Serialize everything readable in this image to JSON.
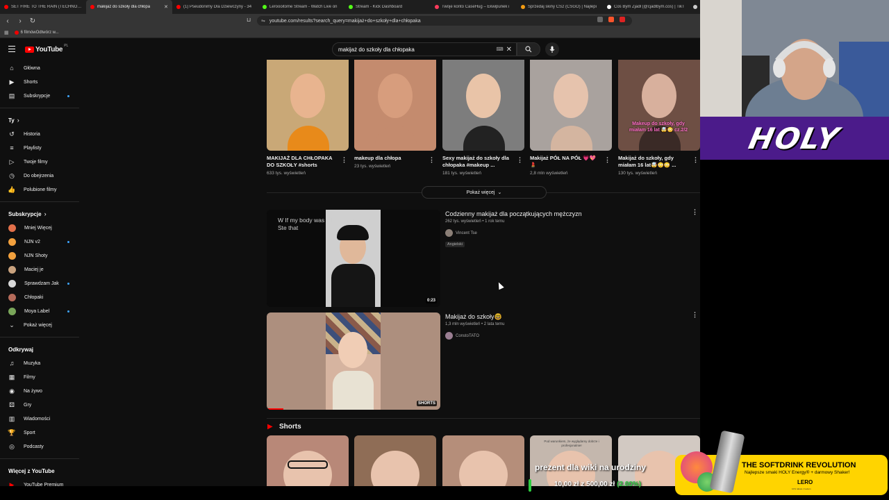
{
  "browser": {
    "tabs": [
      {
        "title": "SET FIRE TO THE RAIN (TECHNO) - Y",
        "color": "#ff0000",
        "active": false
      },
      {
        "title": "makijaż do szkoły dla chłopa",
        "color": "#ff0000",
        "active": true
      },
      {
        "title": "(1) Pseudonimy Dla Dziewczyny - 34",
        "color": "#ff0000",
        "active": false
      },
      {
        "title": "Leroooitome Stream - Watch Live on",
        "color": "#53fc18",
        "active": false
      },
      {
        "title": "Stream - Kick Dashboard",
        "color": "#53fc18",
        "active": false
      },
      {
        "title": "Twoje konto CaseHug – Ekwipunek i",
        "color": "#ff3b5c",
        "active": false
      },
      {
        "title": "Sprzedaj skiny CS2 (CSGO) | Najlepi",
        "color": "#f39c12",
        "active": false
      },
      {
        "title": "Coś Bym Zjadł (@cjadlbym.cos) | TikT",
        "color": "#ffffff",
        "active": false
      },
      {
        "title": "20",
        "color": "#cccccc",
        "active": false
      }
    ],
    "url": "youtube.com/results?search_query=makijaż+do+szkoły+dla+chłopaka",
    "bookmark": "6 filmówOdtwórz w..."
  },
  "youtube": {
    "logo": "YouTube",
    "country": "PL",
    "search_query": "makijaż do szkoły dla chłopaka",
    "sidebar": {
      "main": [
        {
          "label": "Główna",
          "icon": "home-icon"
        },
        {
          "label": "Shorts",
          "icon": "shorts-icon"
        },
        {
          "label": "Subskrypcje",
          "icon": "subscriptions-icon"
        }
      ],
      "you_header": "Ty",
      "you": [
        {
          "label": "Historia",
          "icon": "history-icon"
        },
        {
          "label": "Playlisty",
          "icon": "playlists-icon"
        },
        {
          "label": "Twoje filmy",
          "icon": "your-videos-icon"
        },
        {
          "label": "Do obejrzenia",
          "icon": "watch-later-icon"
        },
        {
          "label": "Polubione filmy",
          "icon": "liked-icon"
        }
      ],
      "subs_header": "Subskrypcje",
      "subs": [
        {
          "label": "Mniej Więcej",
          "color": "#e2704a",
          "dot": false
        },
        {
          "label": "NJN v2",
          "color": "#f2a03d",
          "dot": true
        },
        {
          "label": "NJN Shoty",
          "color": "#f2a03d",
          "dot": false
        },
        {
          "label": "Maciej je",
          "color": "#c9a27e",
          "dot": false
        },
        {
          "label": "Sprawdzam Jak",
          "color": "#d8d8d8",
          "dot": true
        },
        {
          "label": "Chłopaki",
          "color": "#b56b5a",
          "dot": false
        },
        {
          "label": "Moya Label",
          "color": "#7aa65a",
          "dot": true
        },
        {
          "label": "Pokaż więcej",
          "color": "",
          "dot": false
        }
      ],
      "explore_header": "Odkrywaj",
      "explore": [
        {
          "label": "Muzyka",
          "icon": "music-icon"
        },
        {
          "label": "Filmy",
          "icon": "movies-icon"
        },
        {
          "label": "Na żywo",
          "icon": "live-icon"
        },
        {
          "label": "Gry",
          "icon": "gaming-icon"
        },
        {
          "label": "Wiadomości",
          "icon": "news-icon"
        },
        {
          "label": "Sport",
          "icon": "sport-icon"
        },
        {
          "label": "Podcasty",
          "icon": "podcasts-icon"
        }
      ],
      "more_header": "Więcej z YouTube",
      "more": [
        {
          "label": "YouTube Premium",
          "icon": "youtube-premium-icon"
        }
      ]
    },
    "shorts_row": [
      {
        "title": "MAKIJAŻ DLA CHŁOPAKA DO SZKOŁY #shorts",
        "views": "633 tys. wyświetleń",
        "bg": "#c9a877",
        "shirt": "#e88a1a",
        "face": "#e8b48f"
      },
      {
        "title": "makeup dla chłopa",
        "views": "23 tys. wyświetleń",
        "bg": "#c48b6e",
        "shirt": "#c48b6e",
        "face": "#d79d7d"
      },
      {
        "title": "Sexy makijaż do szkoły dla chłopaka #makeup ...",
        "views": "181 tys. wyświetleń",
        "bg": "#7d7d7d",
        "shirt": "#222222",
        "face": "#e9c4a8"
      },
      {
        "title": "Makijaż PÓŁ NA PÓŁ 💗💖💄",
        "views": "2,8 mln wyświetleń",
        "bg": "#a9a29e",
        "shirt": "#d4b5a0",
        "face": "#e6c3ad"
      },
      {
        "title": "Makijaż do szkoły, gdy miałam 16 lat🤯😳😳 ...",
        "views": "130 tys. wyświetleń",
        "bg": "#6e4f44",
        "shirt": "#3a2a26",
        "face": "#d8b09d",
        "overlay": "Makeup do szkoły, gdy miałam 16 lat 🤯😳 cz.2/2"
      }
    ],
    "show_more": "Pokaż więcej",
    "videos": [
      {
        "title": "Codzienny makijaż dla początkujących mężczyzn",
        "meta": "262 tys. wyświetleń • 1 rok temu",
        "channel": "Vincent Tse",
        "badge": "Angielski",
        "duration": "0:23",
        "caption": "W If my body was a boat could you Ste that",
        "avatar": "#8b7f77"
      },
      {
        "title": "Makijaż do szkoły🤓",
        "meta": "1,3 mln wyświetleń • 2 lata temu",
        "channel": "ConstoTATO",
        "badge": "",
        "duration": "SHORTS",
        "caption": "",
        "avatar": "#9a7e92"
      }
    ],
    "shorts_section_title": "Shorts",
    "shorts_bottom": [
      {
        "bg": "#b88878",
        "caption": ""
      },
      {
        "bg": "#8f6d56",
        "caption": ""
      },
      {
        "bg": "#b58e7a",
        "caption": ""
      },
      {
        "bg": "#c4b7ad",
        "caption": "Pod warunkiem, że wyglądamy dobrze i profesjonalnie!"
      },
      {
        "bg": "#d2c9c2",
        "caption": ""
      }
    ]
  },
  "stream_overlay": {
    "holy": "HOLY",
    "donation_text": "prezent dla wiki na urodziny",
    "donation_amount": "10,00 zł z 500,00 zł",
    "donation_pct": "(2.00%)",
    "ad_title": "THE SOFTDRINK REVOLUTION",
    "ad_sub": "Najlepsze smaki HOLY Energy® + darmowy Shaker!",
    "ad_brand": "LERO",
    "ad_fine": "10% rabatu z kodem"
  }
}
